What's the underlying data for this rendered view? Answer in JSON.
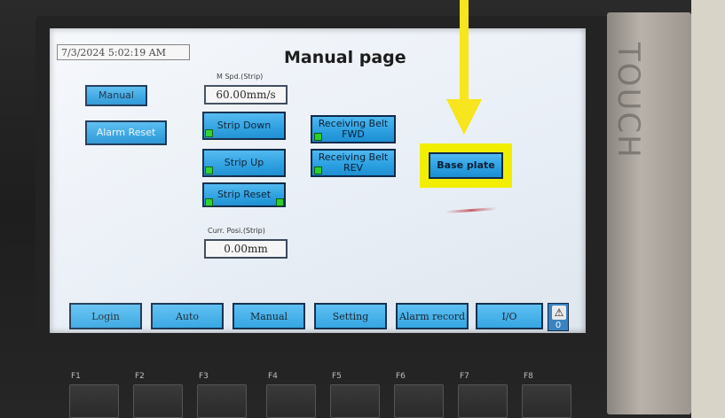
{
  "screen": {
    "datetime": "7/3/2024 5:02:19 AM",
    "title": "Manual page"
  },
  "bezel": {
    "brand_label": "TOUCH"
  },
  "controls": {
    "manual_label": "Manual",
    "alarm_reset_label": "Alarm Reset",
    "speed_label": "M Spd.(Strip)",
    "speed_value": "60.00mm/s",
    "strip_down_label": "Strip Down",
    "strip_up_label": "Strip Up",
    "strip_reset_label": "Strip Reset",
    "position_label": "Curr. Posi.(Strip)",
    "position_value": "0.00mm",
    "receiving_fwd_line1": "Receiving Belt",
    "receiving_fwd_line2": "FWD",
    "receiving_rev_line1": "Receiving Belt",
    "receiving_rev_line2": "REV",
    "base_plate_label": "Base plate"
  },
  "nav": {
    "items": [
      {
        "label": "Login"
      },
      {
        "label": "Auto"
      },
      {
        "label": "Manual"
      },
      {
        "label": "Setting"
      },
      {
        "label": "Alarm record"
      },
      {
        "label": "I/O"
      }
    ],
    "alarm_icon": "warning-triangle-icon",
    "alarm_count": "0"
  },
  "function_keys": [
    {
      "label": "F1"
    },
    {
      "label": "F2"
    },
    {
      "label": "F3"
    },
    {
      "label": "F4"
    },
    {
      "label": "F5"
    },
    {
      "label": "F6"
    },
    {
      "label": "F7"
    },
    {
      "label": "F8"
    }
  ],
  "colors": {
    "button_blue": "#2a9fe0",
    "indicator_green": "#2bd02b",
    "highlight_yellow": "#f2ee00"
  }
}
